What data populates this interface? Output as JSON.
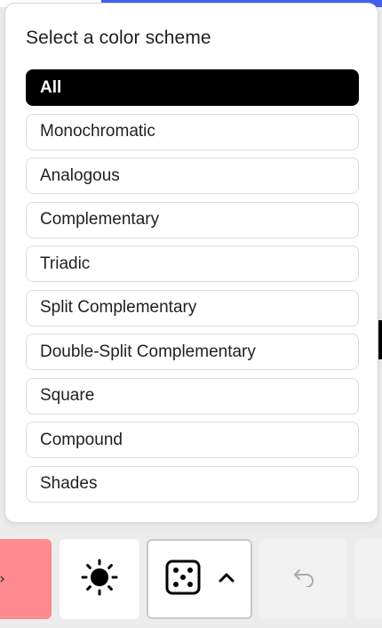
{
  "popover": {
    "title": "Select a color scheme",
    "options": [
      {
        "label": "All",
        "selected": true
      },
      {
        "label": "Monochromatic",
        "selected": false
      },
      {
        "label": "Analogous",
        "selected": false
      },
      {
        "label": "Complementary",
        "selected": false
      },
      {
        "label": "Triadic",
        "selected": false
      },
      {
        "label": "Split Complementary",
        "selected": false
      },
      {
        "label": "Double-Split Complementary",
        "selected": false
      },
      {
        "label": "Square",
        "selected": false
      },
      {
        "label": "Compound",
        "selected": false
      },
      {
        "label": "Shades",
        "selected": false
      }
    ]
  },
  "toolbar": {
    "swatch_color": "#ff8a8f",
    "icons": {
      "theme": "sun-icon",
      "random": "dice-icon",
      "expand": "chevron-up-icon",
      "undo": "undo-icon"
    }
  }
}
